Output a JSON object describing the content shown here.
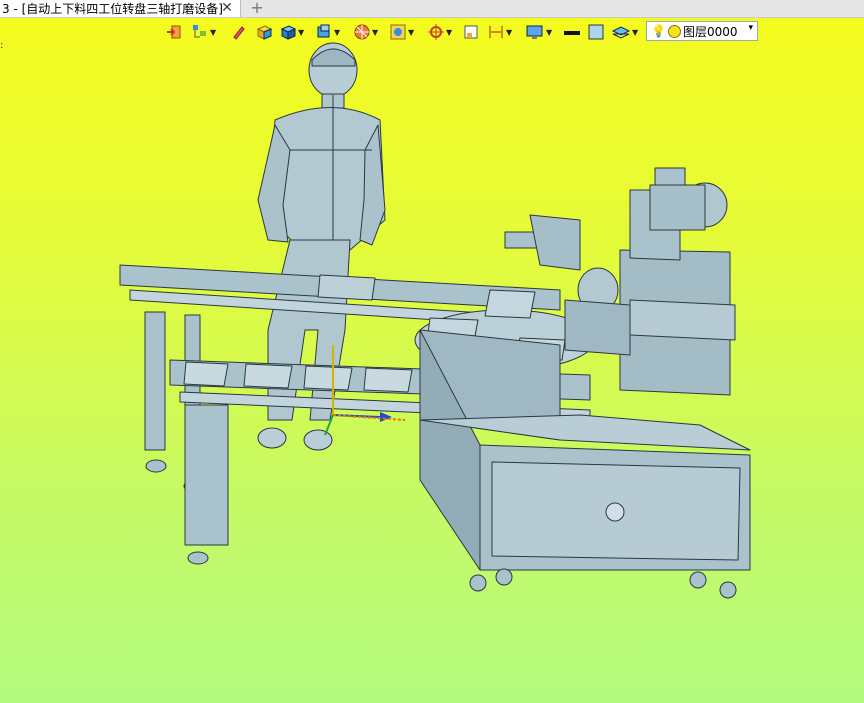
{
  "tab": {
    "title": "3 - [自动上下料四工位转盘三轴打磨设备]",
    "close": "✕",
    "new": "+"
  },
  "layer": {
    "name": "图层0000",
    "arrow": "▾"
  },
  "colors": {
    "model": "#a9c2cc",
    "edge": "#2a3840",
    "accent": "#1e48d8"
  },
  "icons": [
    "exit-icon",
    "tree-icon",
    "pen-icon",
    "box-icon",
    "solid-cube-icon",
    "view-cube-icon",
    "render-icon",
    "display-icon",
    "snap-icon",
    "dimension-icon",
    "monitor-icon",
    "line-color-icon",
    "fill-color-icon",
    "layer-stack-icon",
    "bulb-icon",
    "light-icon"
  ]
}
